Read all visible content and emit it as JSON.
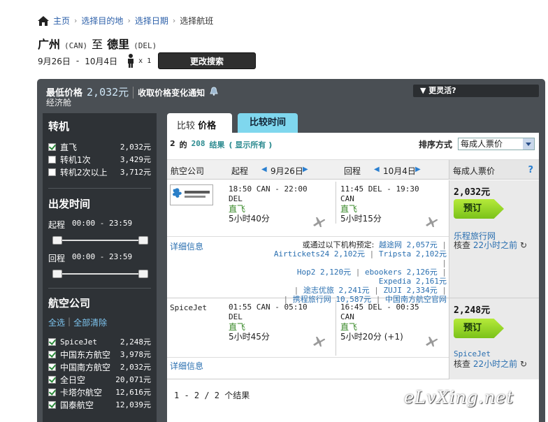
{
  "breadcrumb": {
    "home": "主页",
    "step1": "选择目的地",
    "step2": "选择日期",
    "step3": "选择航班"
  },
  "route": {
    "from": "广州",
    "from_code": "(CAN)",
    "to_word": "至",
    "to": "德里",
    "to_code": "(DEL)"
  },
  "trip": {
    "depart": "9月26日",
    "dash": "-",
    "return": "10月4日",
    "pax": "x 1",
    "change_label": "更改搜索"
  },
  "summary": {
    "label": "最低价格",
    "price": "2,032元",
    "notify": "收取价格变化通知",
    "cabin": "经济舱",
    "flex": "更灵活?"
  },
  "sidebar": {
    "stops_title": "转机",
    "stops": [
      {
        "label": "直飞",
        "amount": "2,032元",
        "checked": true
      },
      {
        "label": "转机1次",
        "amount": "3,429元",
        "checked": false
      },
      {
        "label": "转机2次以上",
        "amount": "3,712元",
        "checked": false
      }
    ],
    "time_title": "出发时间",
    "outbound_label": "起程",
    "outbound_range": "00:00 - 23:59",
    "return_label": "回程",
    "return_range": "00:00 - 23:59",
    "airline_title": "航空公司",
    "select_all": "全选",
    "clear_all": "全部清除",
    "airlines": [
      {
        "label": "SpiceJet",
        "amount": "2,248元",
        "checked": true
      },
      {
        "label": "中国东方航空",
        "amount": "3,978元",
        "checked": true
      },
      {
        "label": "中国南方航空",
        "amount": "2,032元",
        "checked": true
      },
      {
        "label": "全日空",
        "amount": "20,071元",
        "checked": true
      },
      {
        "label": "卡塔尔航空",
        "amount": "12,616元",
        "checked": true
      },
      {
        "label": "国泰航空",
        "amount": "12,039元",
        "checked": true
      }
    ]
  },
  "tabs": {
    "compare_price_pre": "比较",
    "compare_price": "价格",
    "compare_time": "比较时间"
  },
  "results": {
    "shown": "2",
    "of": "的",
    "total": "208",
    "total_suffix": "结果",
    "show_all": "( 显示所有 )",
    "sort_label": "排序方式",
    "sort_value": "每成人票价",
    "header": {
      "airline": "航空公司",
      "outbound": "起程",
      "out_date": "9月26日",
      "return": "回程",
      "ret_date": "10月4日",
      "price": "每成人票价",
      "help": "?"
    },
    "flights": [
      {
        "airline_logo_text": "中国南方航空",
        "out": {
          "time": "18:50 CAN  -  22:00",
          "arr": "DEL",
          "stops": "直飞",
          "duration": "5小时40分"
        },
        "ret": {
          "time": "11:45 DEL  -  19:30",
          "arr": "CAN",
          "stops": "直飞",
          "duration": "5小时15分"
        },
        "price": "2,032元",
        "book": "预订",
        "vendor": "乐程旅行网",
        "checked_pre": "核查",
        "checked_ago": "22小时之前",
        "details": "详细信息",
        "others_title": "或通过以下机构预定:",
        "others": [
          [
            "越途网 2,057元"
          ],
          [
            "Airtickets24 2,102元",
            "Tripsta 2,102元"
          ],
          [
            "Hop2 2,120元",
            "ebookers 2,126元",
            "Expedia 2,161元"
          ],
          [
            "途志优旅 2,241元",
            "ZUJI 2,334元"
          ],
          [
            "携程旅行网 10,587元",
            "中国南方航空官网"
          ]
        ]
      },
      {
        "airline_name": "SpiceJet",
        "out": {
          "time": "01:55 CAN  -  05:10",
          "arr": "DEL",
          "stops": "直飞",
          "duration": "5小时45分"
        },
        "ret": {
          "time": "16:45 DEL  -  00:35",
          "arr": "CAN",
          "stops": "直飞",
          "duration": "5小时20分  (+1)"
        },
        "price": "2,248元",
        "book": "预订",
        "vendor": "SpiceJet",
        "checked_pre": "核查",
        "checked_ago": "22小时之前",
        "details": "详细信息"
      }
    ],
    "pager": "1 - 2 / 2",
    "pager_suffix": "个结果"
  },
  "watermark": "eLvXing.net"
}
